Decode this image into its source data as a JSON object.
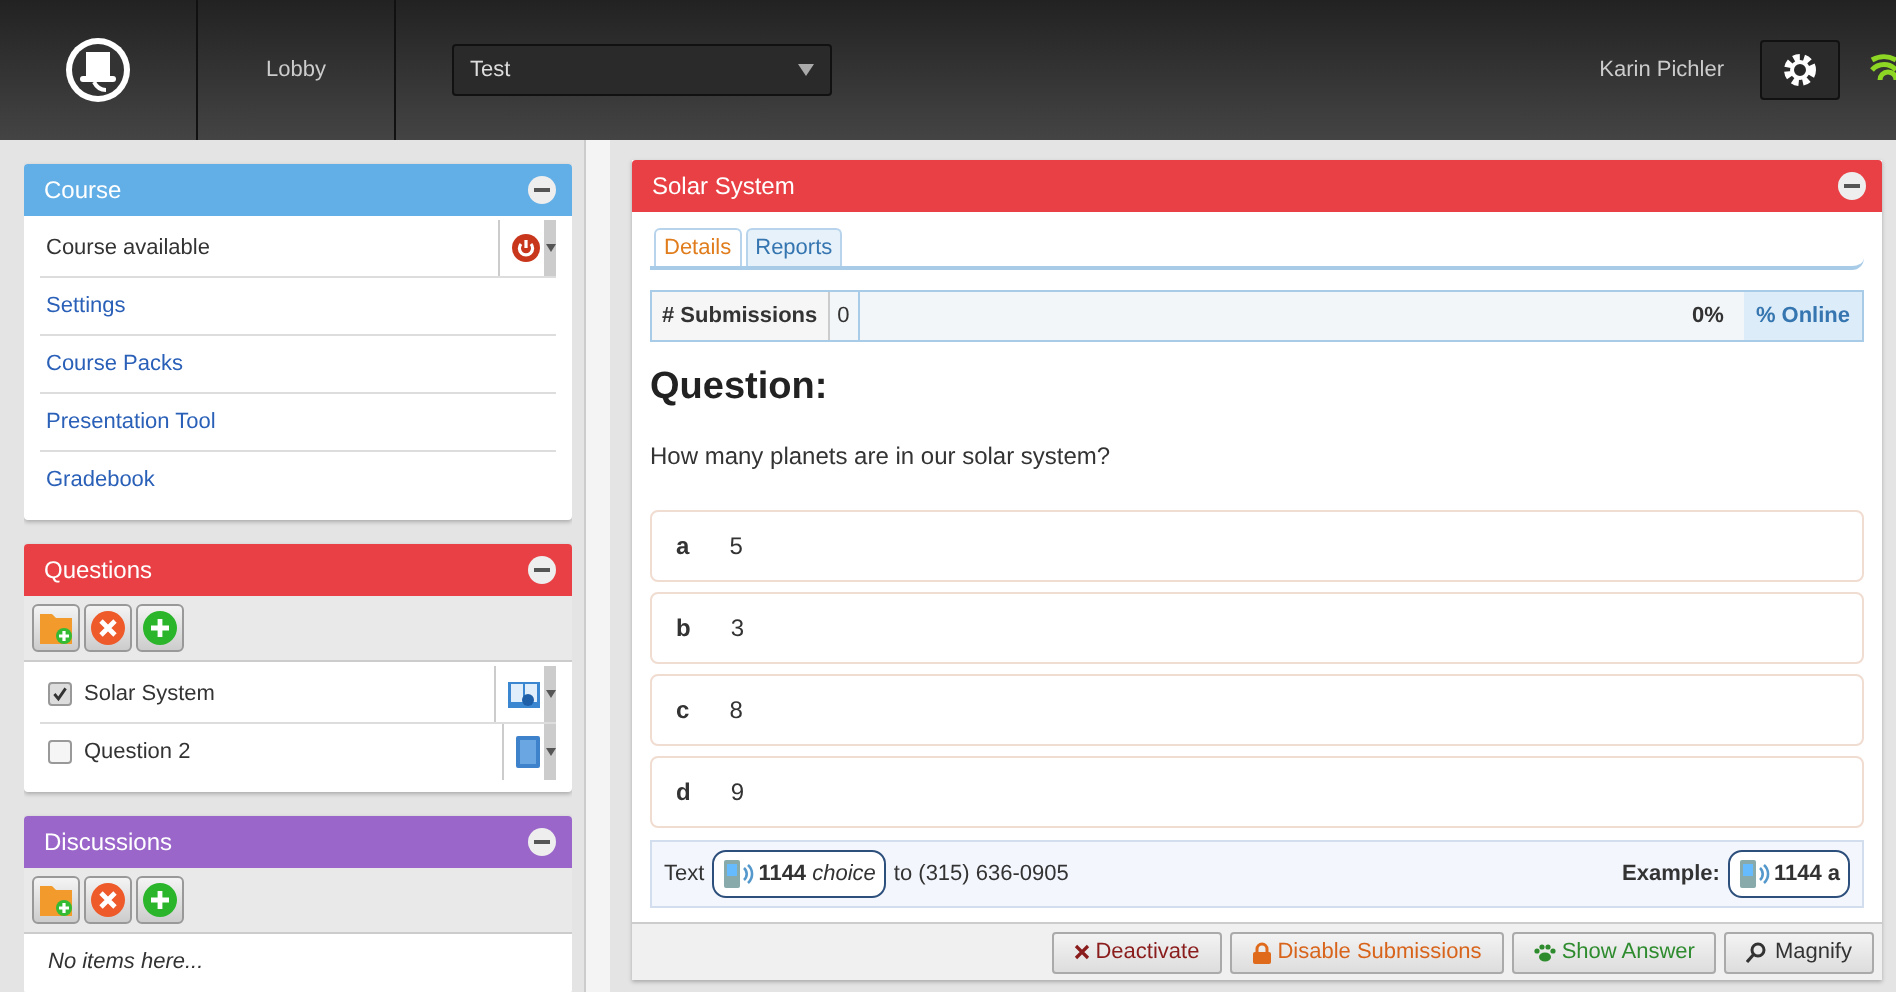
{
  "header": {
    "nav": "Lobby",
    "course_select": "Test",
    "user": "Karin Pichler"
  },
  "sidebar": {
    "panels": [
      {
        "title": "Course",
        "color": "#62aee6",
        "items": [
          {
            "kind": "toggle",
            "label": "Course available"
          },
          {
            "kind": "link",
            "label": "Settings"
          },
          {
            "kind": "link",
            "label": "Course Packs"
          },
          {
            "kind": "link",
            "label": "Presentation Tool"
          },
          {
            "kind": "link",
            "label": "Gradebook"
          }
        ]
      },
      {
        "title": "Questions",
        "color": "#e84044",
        "toolbar": true,
        "items": [
          {
            "kind": "book",
            "label": "Solar System",
            "checked": true
          },
          {
            "kind": "page",
            "label": "Question 2",
            "checked": false
          }
        ]
      },
      {
        "title": "Discussions",
        "color": "#9a66c9",
        "toolbar": true,
        "empty": "No items here..."
      }
    ]
  },
  "main": {
    "title": "Solar System",
    "tabs": [
      {
        "label": "Details",
        "selected": true
      },
      {
        "label": "Reports",
        "selected": false
      }
    ],
    "stats": {
      "label": "# Submissions",
      "count": "0",
      "percent": "0%",
      "level": 0,
      "online": "% Online"
    },
    "heading": "Question:",
    "question": "How many planets are in our solar system?",
    "answers": [
      {
        "letter": "a",
        "text": "5"
      },
      {
        "letter": "b",
        "text": "3"
      },
      {
        "letter": "c",
        "text": "8"
      },
      {
        "letter": "d",
        "text": "9"
      }
    ],
    "sms": {
      "prefix": "Text",
      "code": "**1144** *choice*",
      "suffix": "to (315) 636-0905",
      "example_label": "Example:",
      "example": "1144 a"
    },
    "buttons": [
      {
        "kind": "deactivate",
        "label": "Deactivate"
      },
      {
        "kind": "disable",
        "label": "Disable Submissions"
      },
      {
        "kind": "answer",
        "label": "Show Answer"
      },
      {
        "kind": "magnify",
        "label": "Magnify"
      }
    ]
  }
}
